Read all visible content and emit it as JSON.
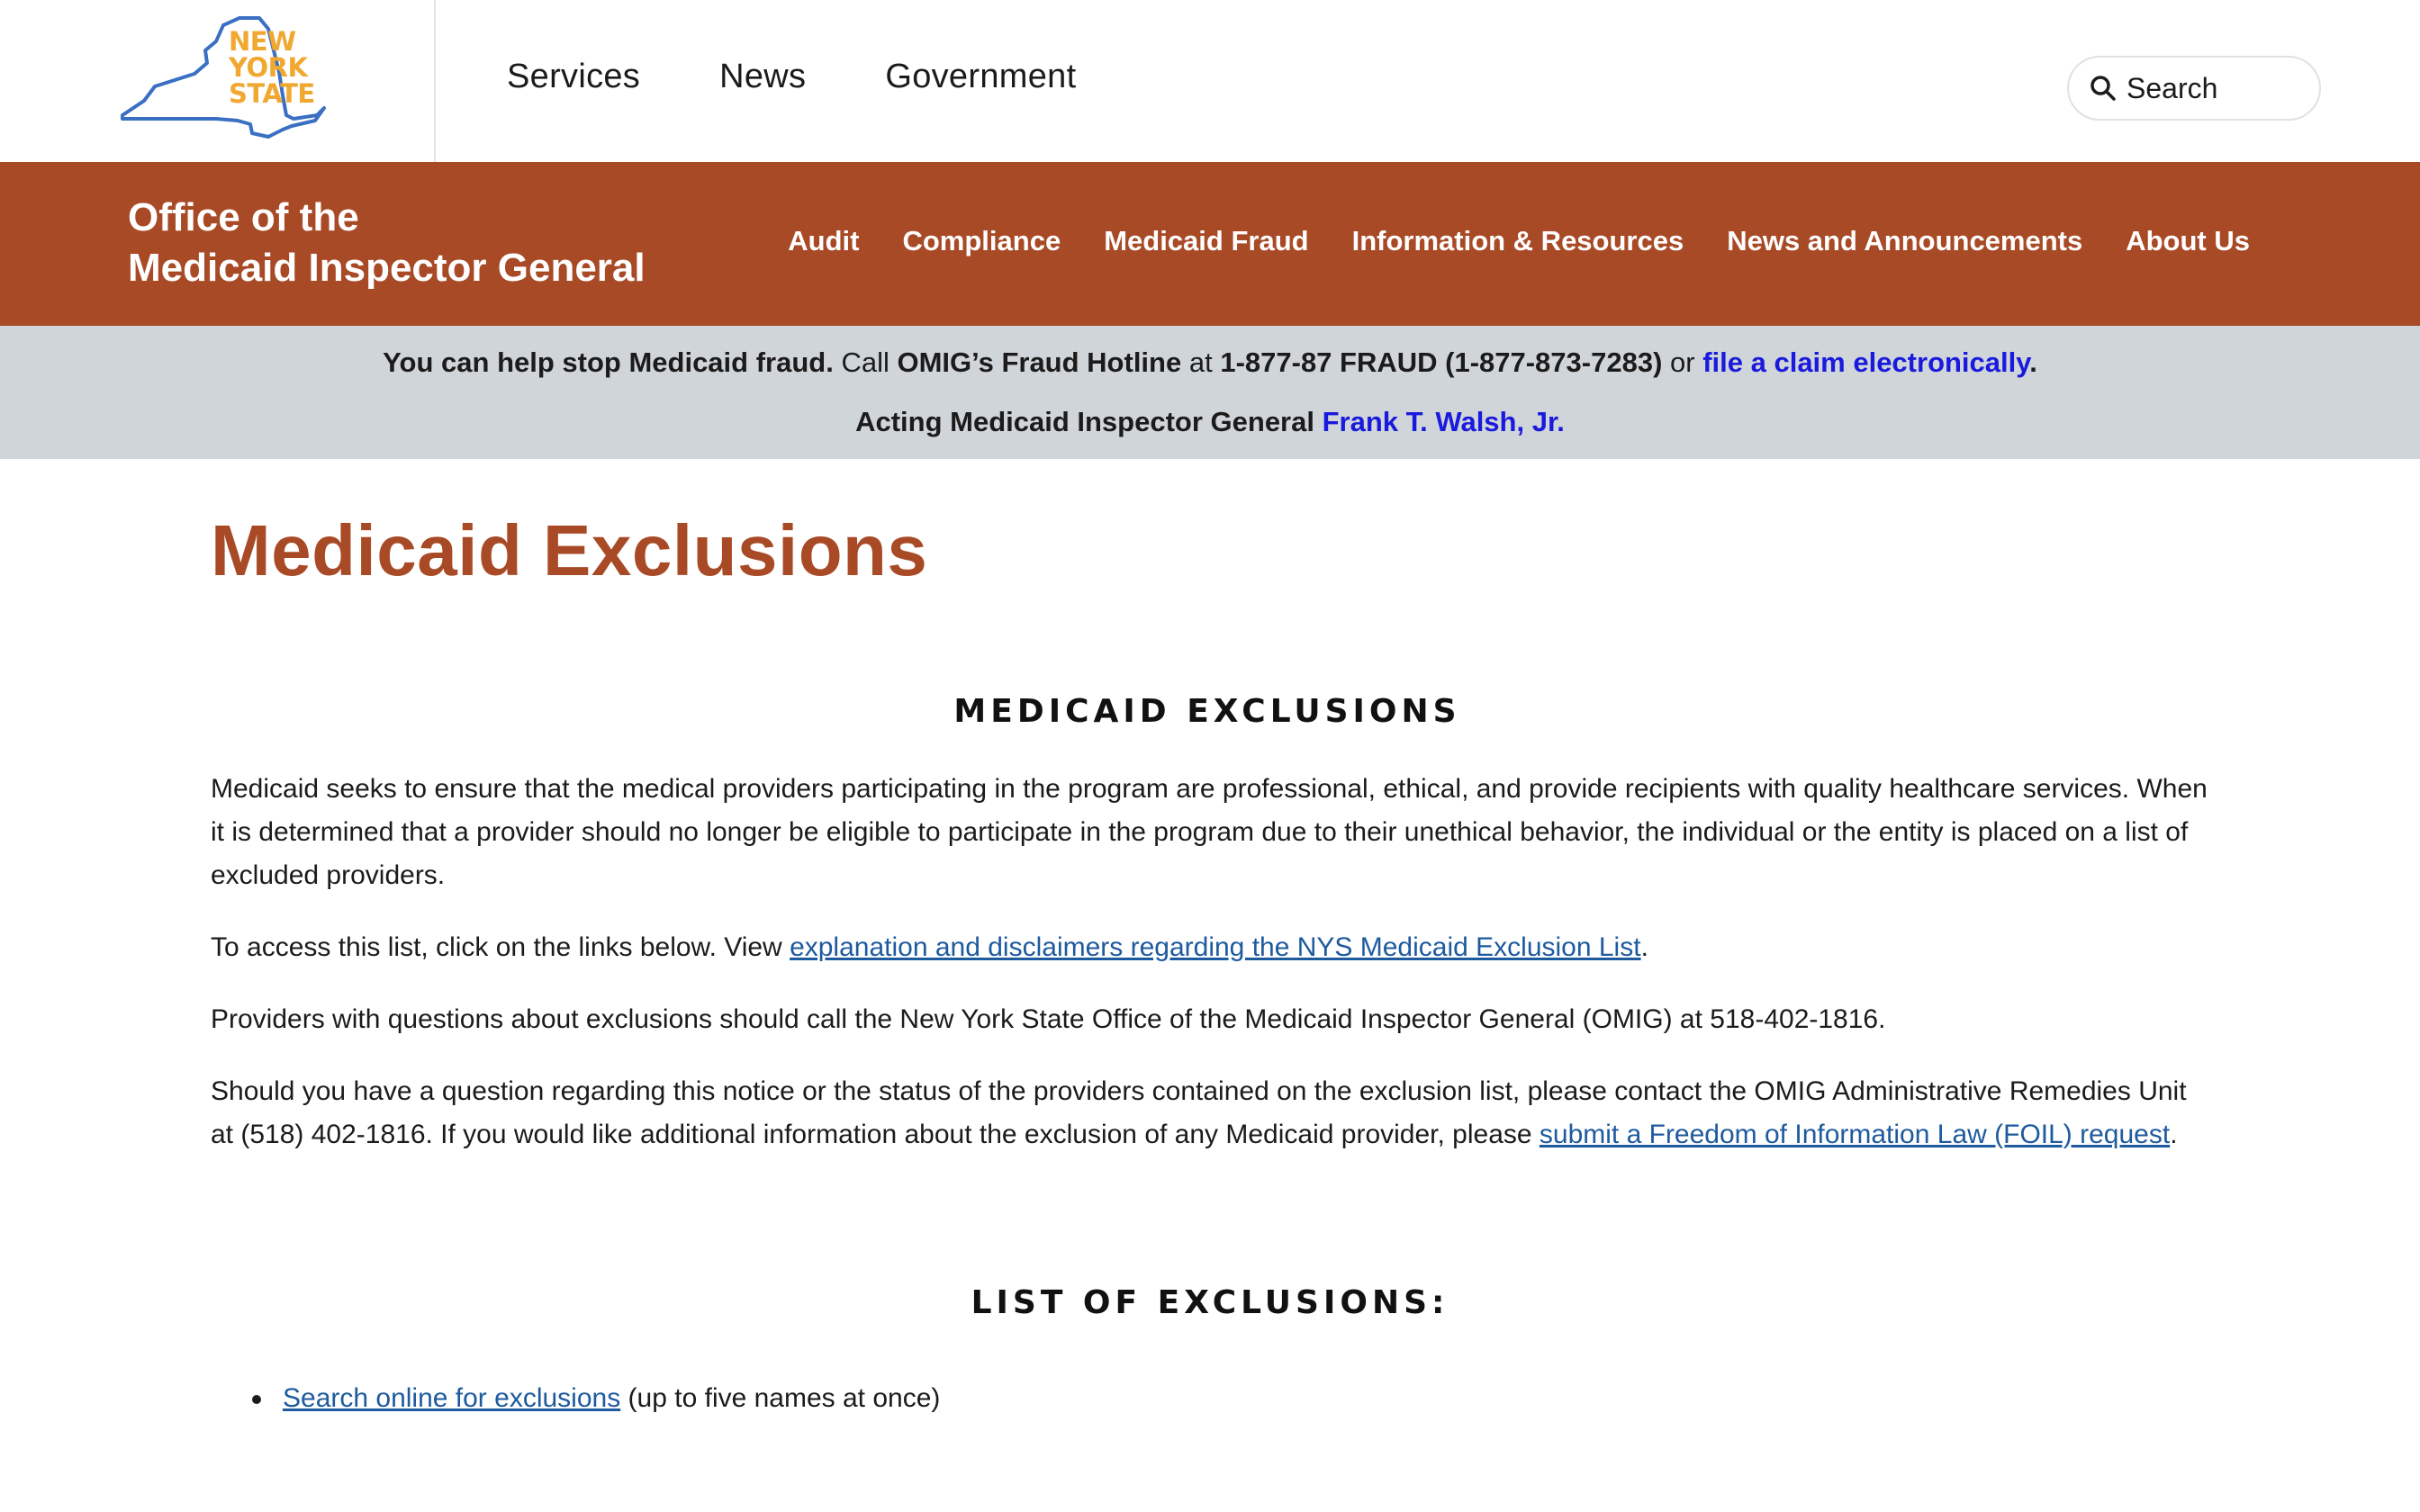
{
  "header": {
    "logo_text": [
      "NEW",
      "YORK",
      "STATE"
    ],
    "nav": [
      {
        "label": "Services"
      },
      {
        "label": "News"
      },
      {
        "label": "Government"
      }
    ],
    "search": {
      "placeholder": "Search"
    }
  },
  "agency": {
    "title_line1": "Office of the",
    "title_line2": "Medicaid Inspector General",
    "nav": [
      {
        "label": "Audit"
      },
      {
        "label": "Compliance"
      },
      {
        "label": "Medicaid Fraud"
      },
      {
        "label": "Information & Resources"
      },
      {
        "label": "News and Announcements"
      },
      {
        "label": "About Us"
      }
    ]
  },
  "alert": {
    "line1_a": "You can help stop Medicaid fraud.",
    "line1_b": " Call ",
    "line1_c": "OMIG’s Fraud Hotline",
    "line1_d": " at ",
    "line1_e": "1-877-87 FRAUD (1-877-873-7283)",
    "line1_f": " or ",
    "line1_link": "file a claim electronically",
    "line1_end": ".",
    "line2_a": "Acting Medicaid Inspector General ",
    "line2_link": "Frank T. Walsh, Jr."
  },
  "main": {
    "title": "Medicaid Exclusions",
    "heading1": "MEDICAID EXCLUSIONS",
    "p1": "Medicaid seeks to ensure that the medical providers participating in the program are professional, ethical, and provide recipients with quality healthcare services. When it is determined that a provider should no longer be eligible to participate in the program due to their unethical behavior, the individual or the entity is placed on a list of excluded providers.",
    "p2_text": "To access this list, click on the links below. View ",
    "p2_link": "explanation and disclaimers regarding the NYS Medicaid Exclusion List",
    "p2_end": ".",
    "p3": "Providers with questions about exclusions should call the New York State Office of the Medicaid Inspector General (OMIG) at 518-402-1816.",
    "p4_text": "Should you have a question regarding this notice or the status of the providers contained on the exclusion list, please contact the OMIG Administrative Remedies Unit at (518) 402-1816. If you would like additional information about the exclusion of any Medicaid provider, please ",
    "p4_link": "submit a Freedom of Information Law (FOIL) request",
    "p4_end": ".",
    "heading2": "LIST OF EXCLUSIONS:",
    "list": [
      {
        "link": "Search online for exclusions",
        "suffix": " (up to five names at once)"
      }
    ]
  },
  "colors": {
    "agency_brand": "#a94a27",
    "alert_bg": "#d0d5da",
    "link": "#1d5a9e",
    "alert_link": "#1a1adc",
    "logo_orange": "#f0a830",
    "logo_blue": "#3a6fc4"
  }
}
